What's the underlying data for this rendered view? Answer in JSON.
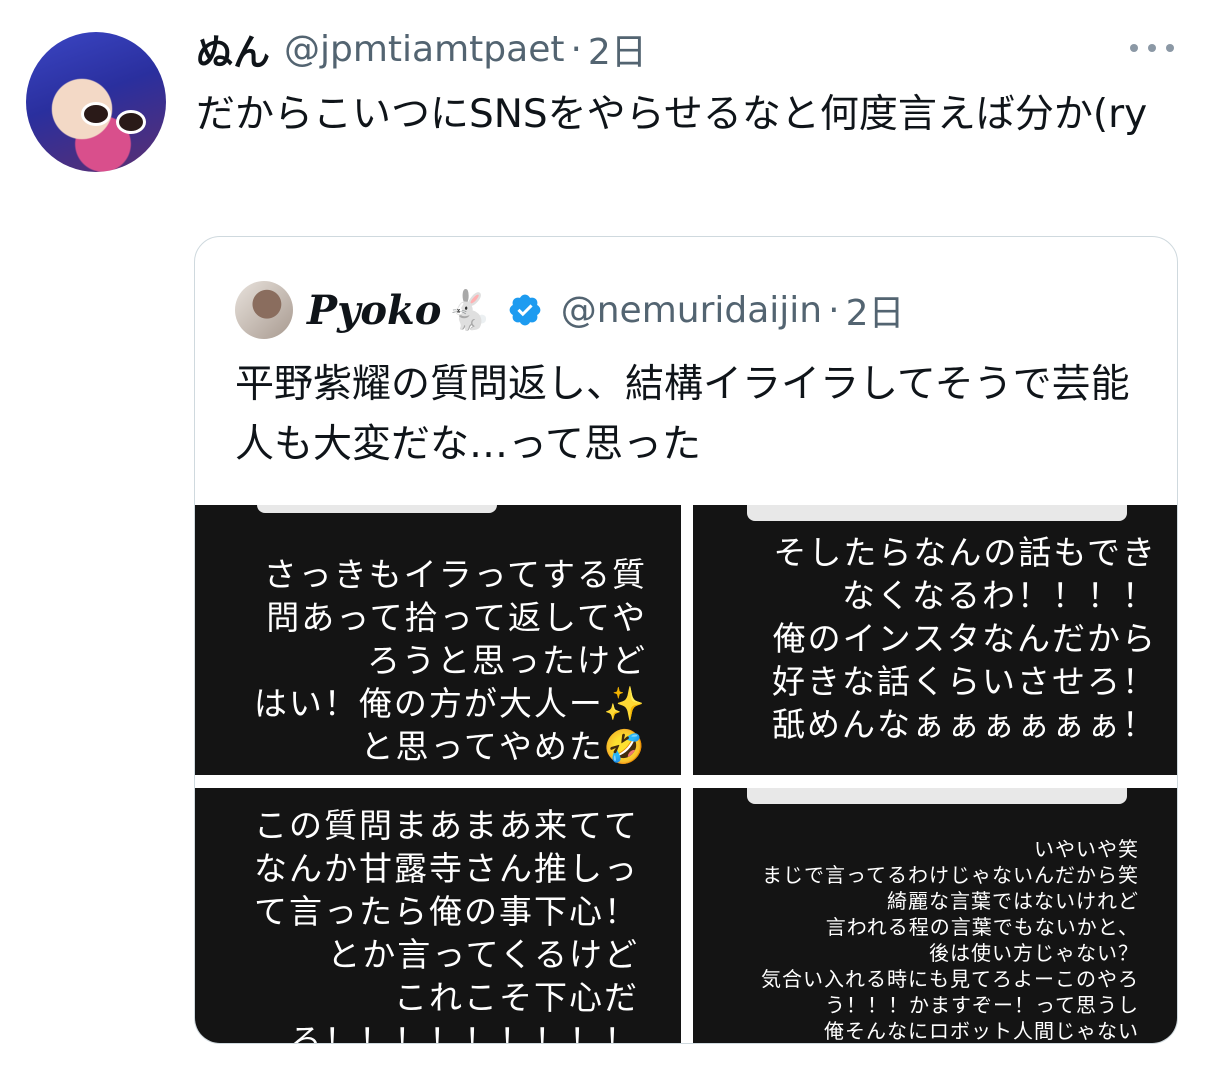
{
  "tweet": {
    "name": "ぬん",
    "handle": "@jpmtiamtpaet",
    "separator": "·",
    "time": "2日",
    "text": "だからこいつにSNSをやらせるなと何度言えば分か(ry"
  },
  "quote": {
    "name": "Pyoko",
    "emoji": "🐇",
    "handle": "@nemuridaijin",
    "separator": "·",
    "time": "2日",
    "text": "平野紫耀の質問返し、結構イライラしてそうで芸能人も大変だな…って思った",
    "images": [
      {
        "text": "さっきもイラってする質\n問あって拾って返してや\nろうと思ったけど\nはい！俺の方が大人ー✨\nと思ってやめた🤣"
      },
      {
        "text": "そしたらなんの話もでき\nなくなるわ！！！！\n俺のインスタなんだから\n好きな話くらいさせろ！\n舐めんなぁぁぁぁぁぁ！"
      },
      {
        "text": "この質問まあまあ来てて\nなんか甘露寺さん推しっ\nて言ったら俺の事下心！\nとか言ってくるけど\nこれこそ下心だ\nろ！！！！！！！！！"
      },
      {
        "text": "いやいや笑\nまじで言ってるわけじゃないんだから笑\n綺麗な言葉ではないけれど\n言われる程の言葉でもないかと、\n後は使い方じゃない？\n気合い入れる時にも見てろよーこのやろ\nう！！！かますぞー！って思うし\n俺そんなにロボット人間じゃない"
      }
    ]
  },
  "colors": {
    "text": "#0f1419",
    "secondary": "#536471",
    "verified": "#1d9bf0",
    "border": "#cfd9de"
  }
}
